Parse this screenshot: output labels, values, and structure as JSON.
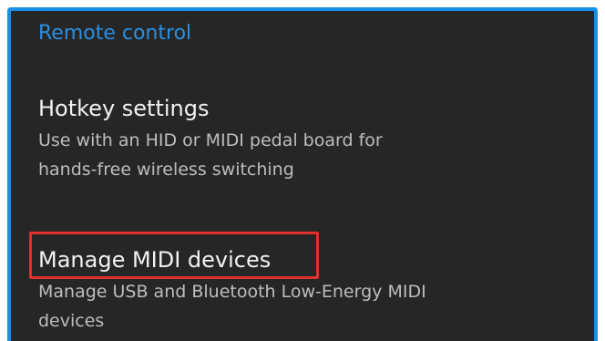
{
  "settings": {
    "section_header": "Remote control",
    "items": [
      {
        "title": "Hotkey settings",
        "summary_line1": "Use with an HID or MIDI pedal board for",
        "summary_line2": "hands-free wireless switching"
      },
      {
        "title": "Manage MIDI devices",
        "summary_line1": "Manage USB and Bluetooth Low-Energy MIDI",
        "summary_line2": "devices"
      }
    ]
  },
  "colors": {
    "panel_border": "#1a8fe6",
    "panel_background": "#262626",
    "section_header": "#2b8ee0",
    "highlight": "#e0312b"
  }
}
